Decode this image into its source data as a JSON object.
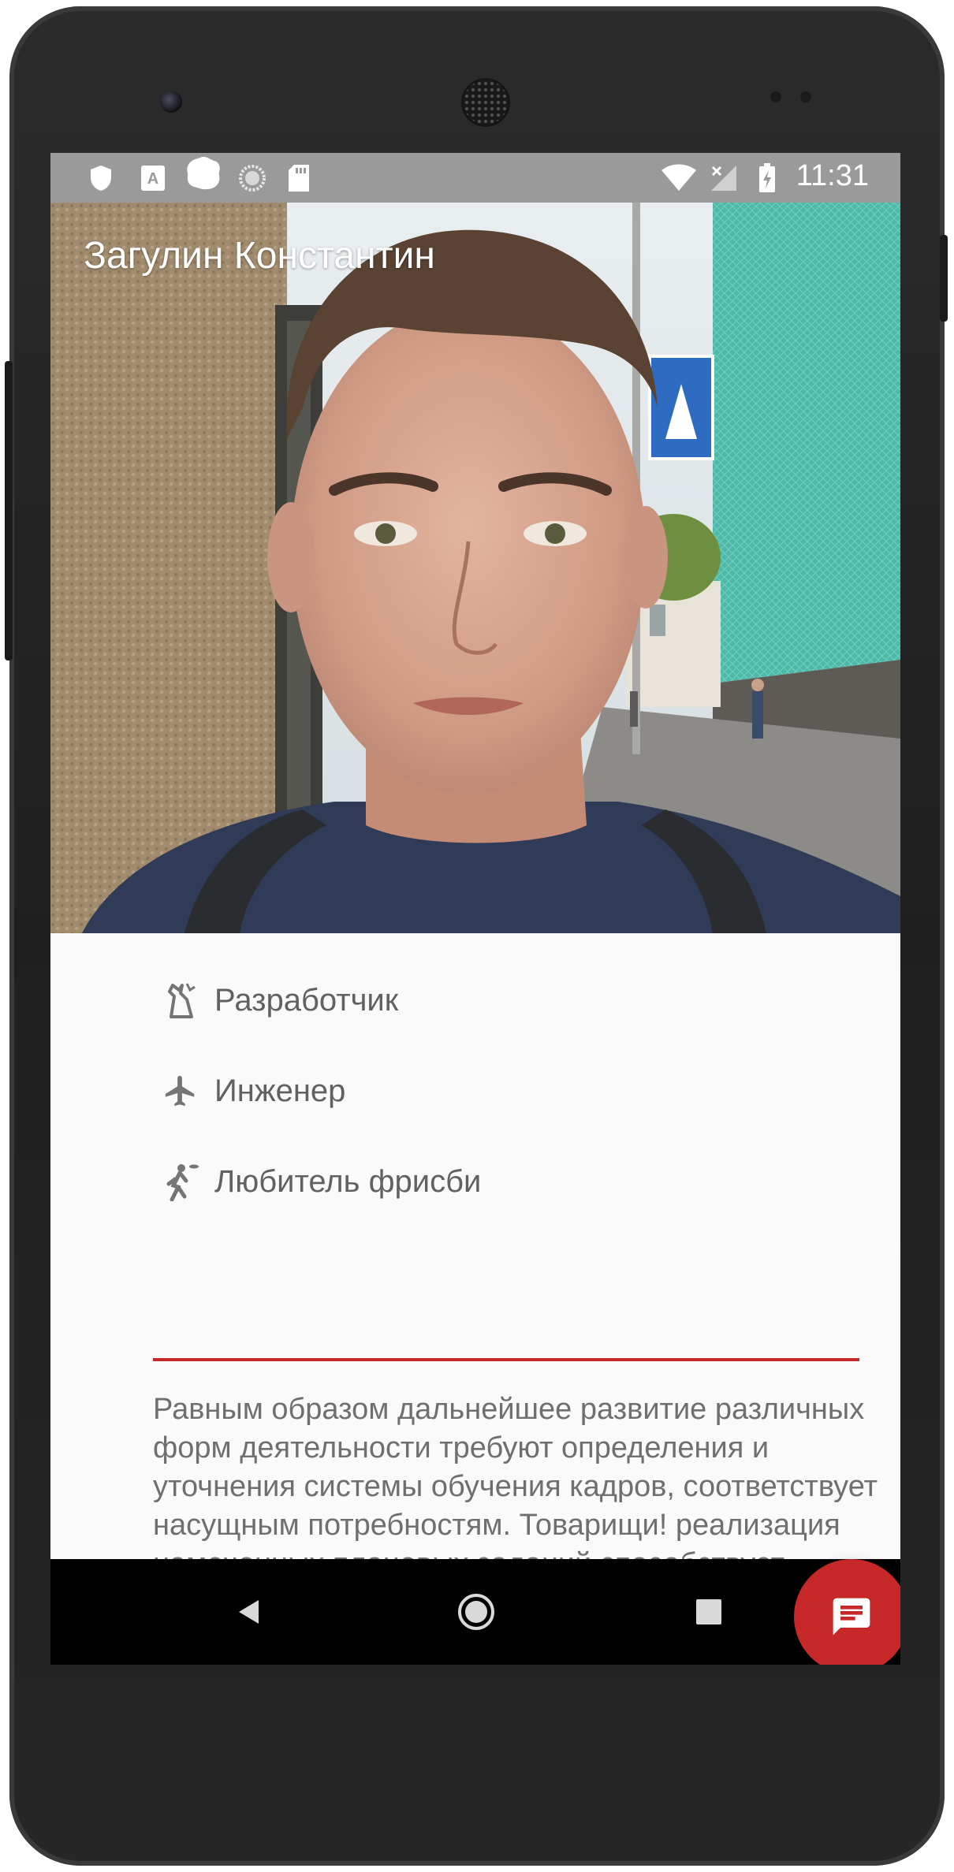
{
  "status_bar": {
    "time": "11:31",
    "left_icons": [
      "shield-icon",
      "app-a-icon",
      "notification-blob-icon",
      "loading-icon",
      "sd-card-icon"
    ],
    "right_icons": [
      "wifi-icon",
      "signal-no-sim-icon",
      "battery-charging-icon"
    ]
  },
  "profile": {
    "name": "Загулин Константин"
  },
  "roles": [
    {
      "label": "Разработчик",
      "icon": "developer-icon"
    },
    {
      "label": "Инженер",
      "icon": "airplane-icon"
    },
    {
      "label": "Любитель фрисби",
      "icon": "frisbee-player-icon"
    }
  ],
  "description": "Равным образом дальнейшее развитие различных форм деятельности требуют определения и уточнения системы обучения кадров, соответствует насущным потребностям. Товарищи! реализация намеченных плановых заданий способствует подготовки и реализации позиций, занимаемых участниками",
  "fab": {
    "icon": "message-icon"
  },
  "nav": {
    "back": "back-icon",
    "home": "home-icon",
    "recents": "recents-icon"
  },
  "colors": {
    "accent": "#c62828",
    "status_bar": "#9a9a9a",
    "text": "#616161",
    "background": "#fafafa"
  }
}
